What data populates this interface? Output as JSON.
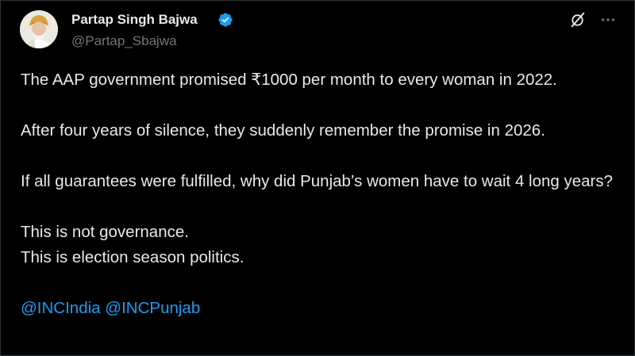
{
  "author": {
    "display_name": "Partap Singh Bajwa",
    "handle": "@Partap_Sbajwa",
    "verified": true,
    "verified_color": "#1d9bf0"
  },
  "actions": {
    "grok_icon": "grok-icon",
    "more_icon": "more-icon"
  },
  "post": {
    "paragraphs": [
      "The AAP government promised ₹1000 per month to every woman in 2022.",
      "After four years of silence, they suddenly remember the promise in 2026.",
      "If all guarantees were fulfilled, why did Punjab’s women have to wait 4 long years?"
    ],
    "closing_lines": [
      "This is not governance.",
      "This is election season politics."
    ],
    "mentions": [
      "@INCIndia",
      "@INCPunjab"
    ]
  },
  "colors": {
    "background": "#000000",
    "text": "#e7e9ea",
    "secondary_text": "#71767b",
    "link": "#1d9bf0"
  }
}
